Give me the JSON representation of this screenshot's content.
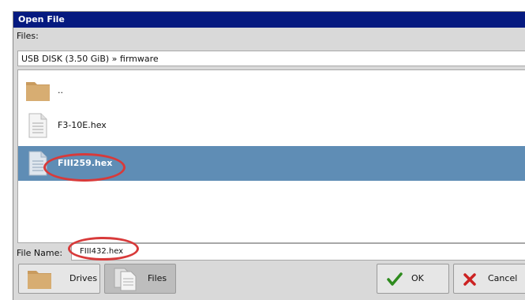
{
  "dialog": {
    "title": "Open File"
  },
  "files_label": "Files:",
  "path": "USB DISK (3.50 GiB) » firmware",
  "files": [
    {
      "label": "..",
      "icon": "folder-icon",
      "selected": false
    },
    {
      "label": "F3-10E.hex",
      "icon": "file-icon",
      "selected": false
    },
    {
      "label": "FIII259.hex",
      "icon": "file-icon",
      "selected": true
    }
  ],
  "file_name": {
    "label": "File Name:",
    "value": "FIII432.hex"
  },
  "buttons": {
    "drives": "Drives",
    "files": "Files",
    "ok": "OK",
    "cancel": "Cancel"
  },
  "colors": {
    "titlebar": "#061a80",
    "selection": "#5f8db5",
    "highlight_oval": "#d83a3a",
    "ok_check": "#2e8b1e",
    "cancel_x": "#cc2222"
  }
}
